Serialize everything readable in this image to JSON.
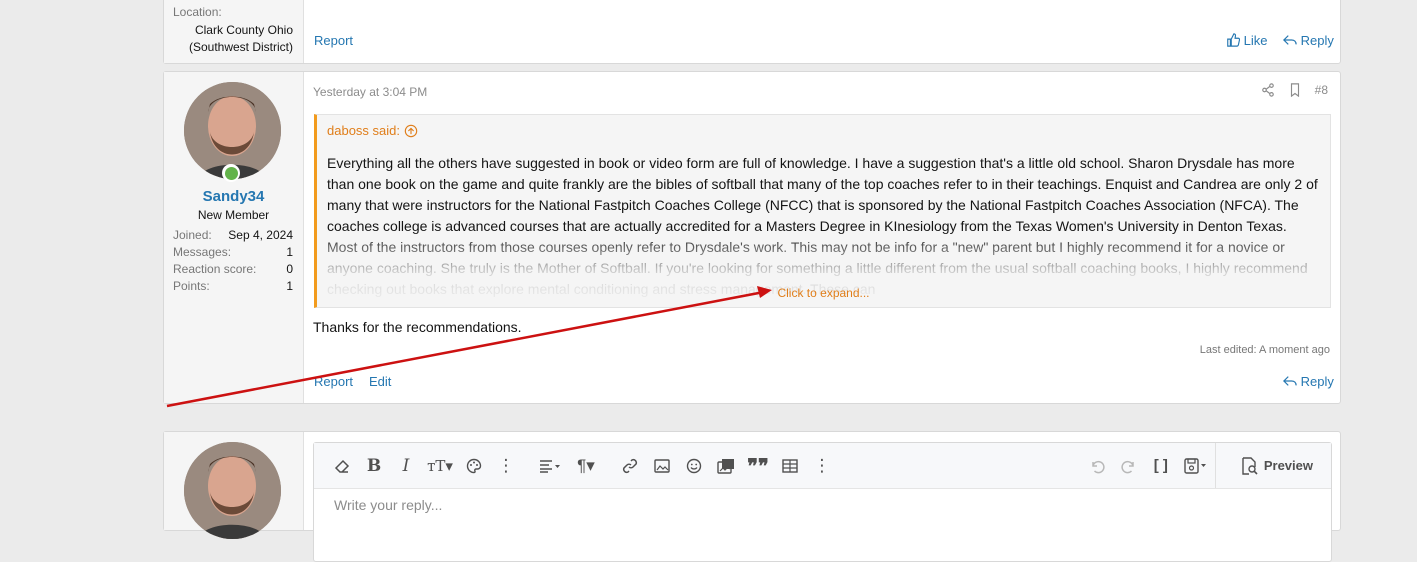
{
  "post_prev": {
    "location_label": "Location:",
    "location_value_1": "Clark County Ohio",
    "location_value_2": "(Southwest District)",
    "report": "Report",
    "like": "Like",
    "reply": "Reply"
  },
  "post_main": {
    "username": "Sandy34",
    "user_title": "New Member",
    "stats": [
      {
        "key": "Joined:",
        "value": "Sep 4, 2024"
      },
      {
        "key": "Messages:",
        "value": "1"
      },
      {
        "key": "Reaction score:",
        "value": "0"
      },
      {
        "key": "Points:",
        "value": "1"
      }
    ],
    "date": "Yesterday at 3:04 PM",
    "post_number": "#8",
    "quote_author": "daboss said:",
    "quote_text": "Everything all the others have suggested in book or video form are full of knowledge. I have a suggestion that's a little old school. Sharon Drysdale has more than one book on the game and quite frankly are the bibles of softball that many of the top coaches refer to in their teachings. Enquist and Candrea are only 2 of many that were instructors for the National Fastpitch Coaches College (NFCC) that is sponsored by the National Fastpitch Coaches Association (NFCA). The coaches college is advanced courses that are actually accredited for a Masters Degree in KInesiology from the Texas Women's University in Denton Texas. Most of the instructors from those courses openly refer to Drysdale's work. This may not be info for a \"new\" parent but I highly recommend it for a novice or anyone coaching. She truly is the Mother of Softball. If you're looking for something a little different from the usual softball coaching books, I highly recommend checking out books that explore mental conditioning and stress management. These can",
    "expand": "Click to expand...",
    "body": "Thanks for the recommendations.",
    "last_edited": "Last edited: A moment ago",
    "report": "Report",
    "edit": "Edit",
    "reply": "Reply"
  },
  "reply_editor": {
    "placeholder": "Write your reply...",
    "preview": "Preview"
  },
  "colors": {
    "link": "#2577b1",
    "quote_accent": "#f29b1d",
    "annotation_arrow": "#cc1111",
    "online": "#63b34a"
  }
}
